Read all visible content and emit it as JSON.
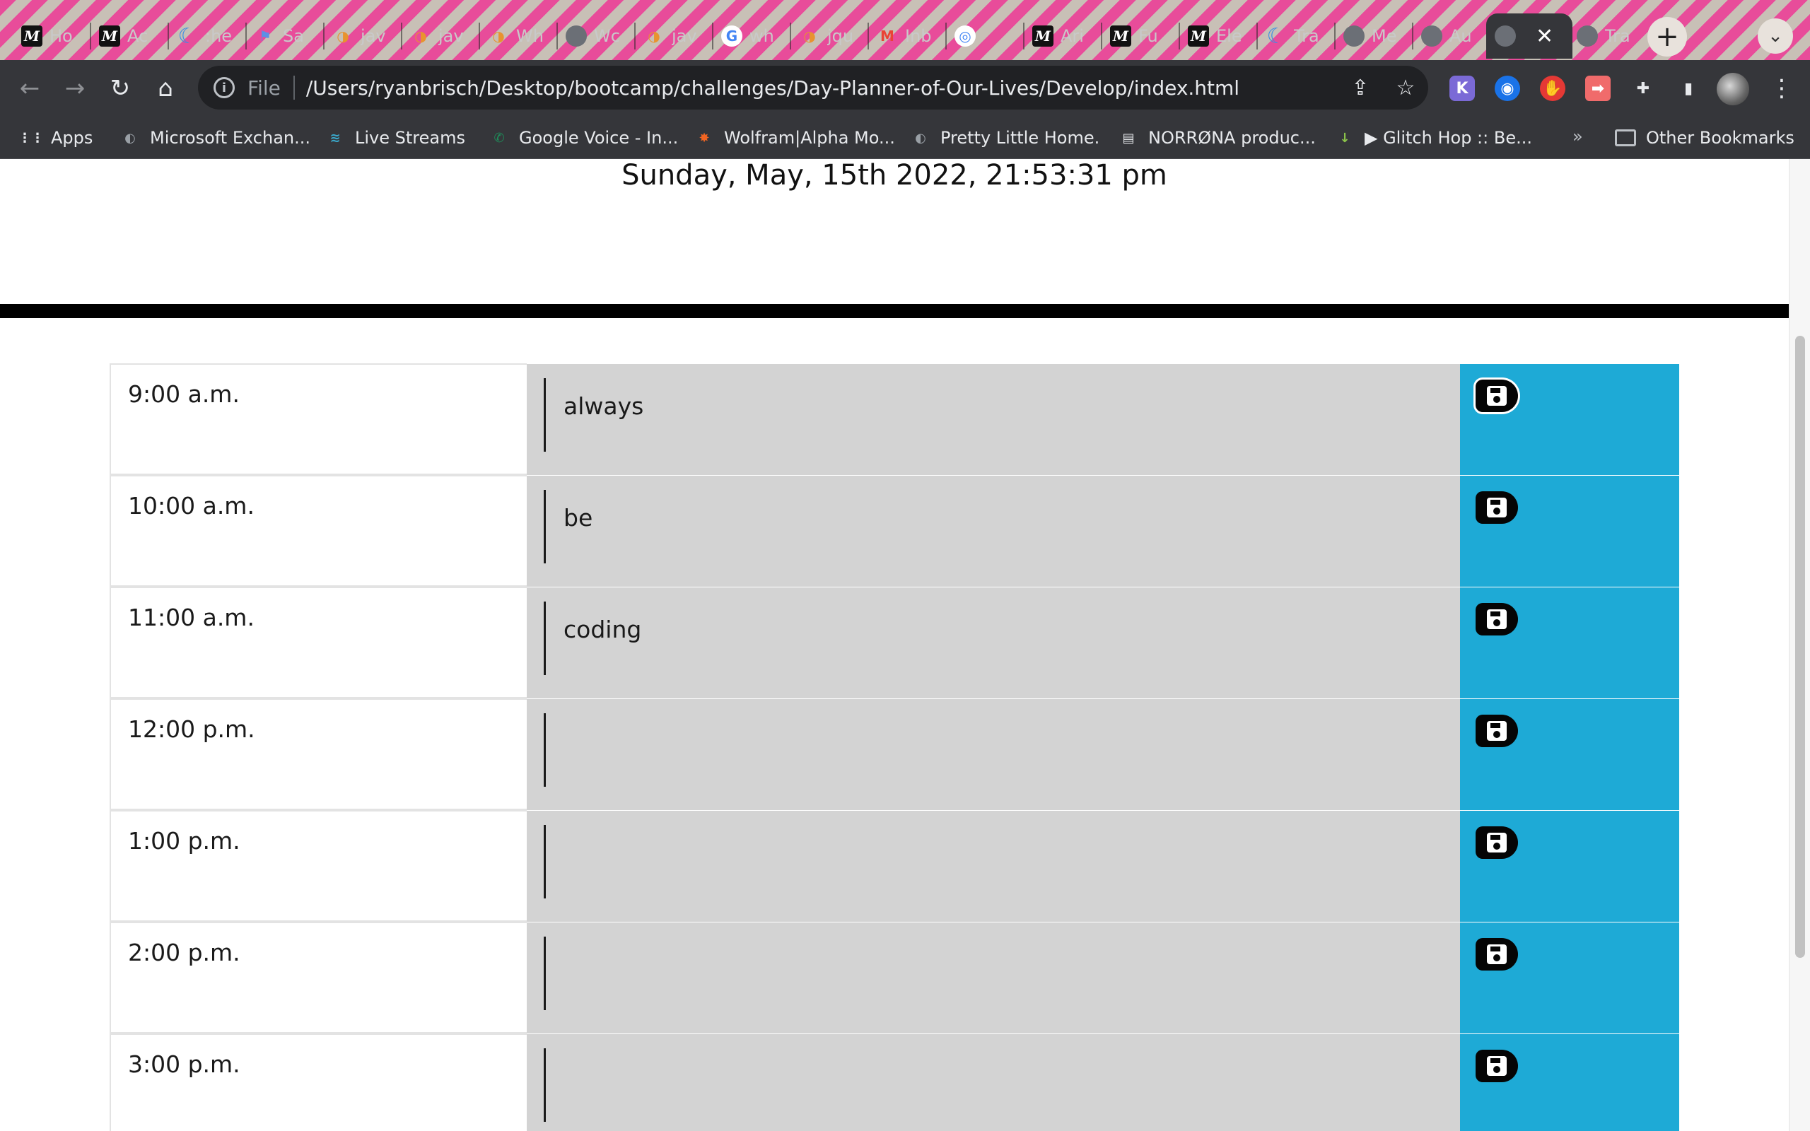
{
  "browser": {
    "tabs": [
      {
        "title": "Ho",
        "icon": "m-icon"
      },
      {
        "title": "Ac",
        "icon": "m-icon"
      },
      {
        "title": ":he",
        "icon": "jquery-icon"
      },
      {
        "title": "Sa",
        "icon": "flag-icon"
      },
      {
        "title": "jav",
        "icon": "orange-icon"
      },
      {
        "title": "jav",
        "icon": "orange-icon"
      },
      {
        "title": "Wh",
        "icon": "orange-icon"
      },
      {
        "title": "Wc",
        "icon": "globe-icon"
      },
      {
        "title": "jav",
        "icon": "orange-icon"
      },
      {
        "title": "wh",
        "icon": "google-icon"
      },
      {
        "title": "jqu",
        "icon": "orange-icon"
      },
      {
        "title": "Inb",
        "icon": "gmail-icon"
      },
      {
        "title": "",
        "icon": "ext-icon"
      },
      {
        "title": "Ari",
        "icon": "m-icon"
      },
      {
        "title": "Fu",
        "icon": "m-icon"
      },
      {
        "title": "Ele",
        "icon": "m-icon"
      },
      {
        "title": "Tra",
        "icon": "jquery-icon"
      },
      {
        "title": "Me",
        "icon": "globe-icon"
      },
      {
        "title": "Au",
        "icon": "globe-icon"
      },
      {
        "title": "",
        "icon": "globe-icon",
        "active": true
      },
      {
        "title": "Tra",
        "icon": "globe-icon"
      }
    ],
    "active_tab_close": "✕",
    "new_tab": "+",
    "address_scheme": "File",
    "address_url": "/Users/ryanbrisch/Desktop/bootcamp/challenges/Day-Planner-of-Our-Lives/Develop/index.html",
    "bookmarks": [
      {
        "label": "Apps",
        "icon": "apps-icon"
      },
      {
        "label": "Microsoft Exchan...",
        "icon": "globe-icon"
      },
      {
        "label": "Live Streams",
        "icon": "stream-icon"
      },
      {
        "label": "Google Voice - In...",
        "icon": "phone-icon"
      },
      {
        "label": "Wolfram|Alpha Mo...",
        "icon": "wolfram-icon"
      },
      {
        "label": "Pretty Little Home.",
        "icon": "globe-icon"
      },
      {
        "label": "NORRØNA produc...",
        "icon": "page-icon"
      },
      {
        "label": "▶ Glitch Hop :: Be...",
        "icon": "download-icon"
      }
    ],
    "bookmarks_overflow": "»",
    "other_bookmarks": "Other Bookmarks"
  },
  "page": {
    "current_day": "Sunday, May, 15th 2022, 21:53:31 pm",
    "time_blocks": [
      {
        "hour": "9:00 a.m.",
        "text": "always"
      },
      {
        "hour": "10:00 a.m.",
        "text": "be"
      },
      {
        "hour": "11:00 a.m.",
        "text": "coding"
      },
      {
        "hour": "12:00 p.m.",
        "text": ""
      },
      {
        "hour": "1:00 p.m.",
        "text": ""
      },
      {
        "hour": "2:00 p.m.",
        "text": ""
      },
      {
        "hour": "3:00 p.m.",
        "text": ""
      }
    ]
  },
  "colors": {
    "past_block": "#d3d3d3",
    "save_column": "#1eaad6",
    "divider": "#000000"
  }
}
